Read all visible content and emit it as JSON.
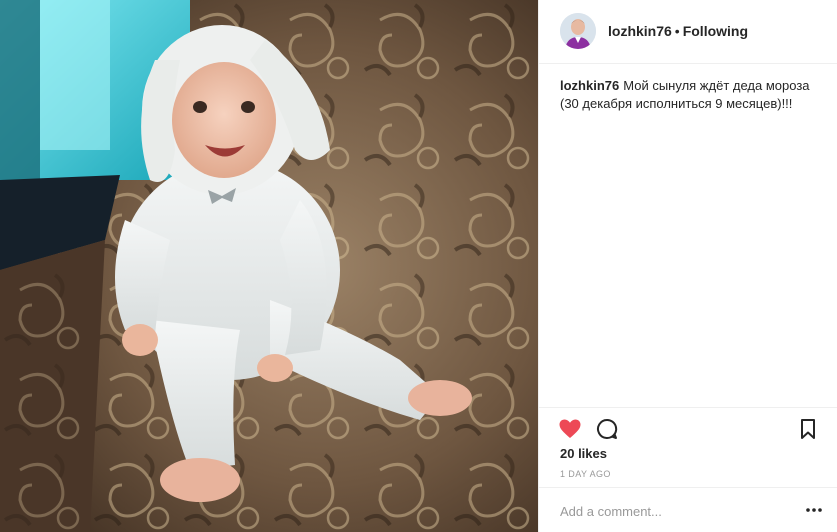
{
  "post": {
    "username": "lozhkin76",
    "separator": "•",
    "follow_status": "Following",
    "caption_user": "lozhkin76",
    "caption_text": "Мой сынуля ждёт деда мороза (30 декабря исполниться 9 месяцев)!!!",
    "likes": "20 likes",
    "timestamp": "1 DAY AGO",
    "comment_placeholder": "Add a comment...",
    "liked": true
  },
  "icons": {
    "like": "heart-icon",
    "comment": "comment-icon",
    "save": "bookmark-icon",
    "more": "more-options-icon"
  },
  "colors": {
    "like_red": "#ed4956",
    "text": "#262626",
    "muted": "#999999",
    "divider": "#efefef"
  }
}
